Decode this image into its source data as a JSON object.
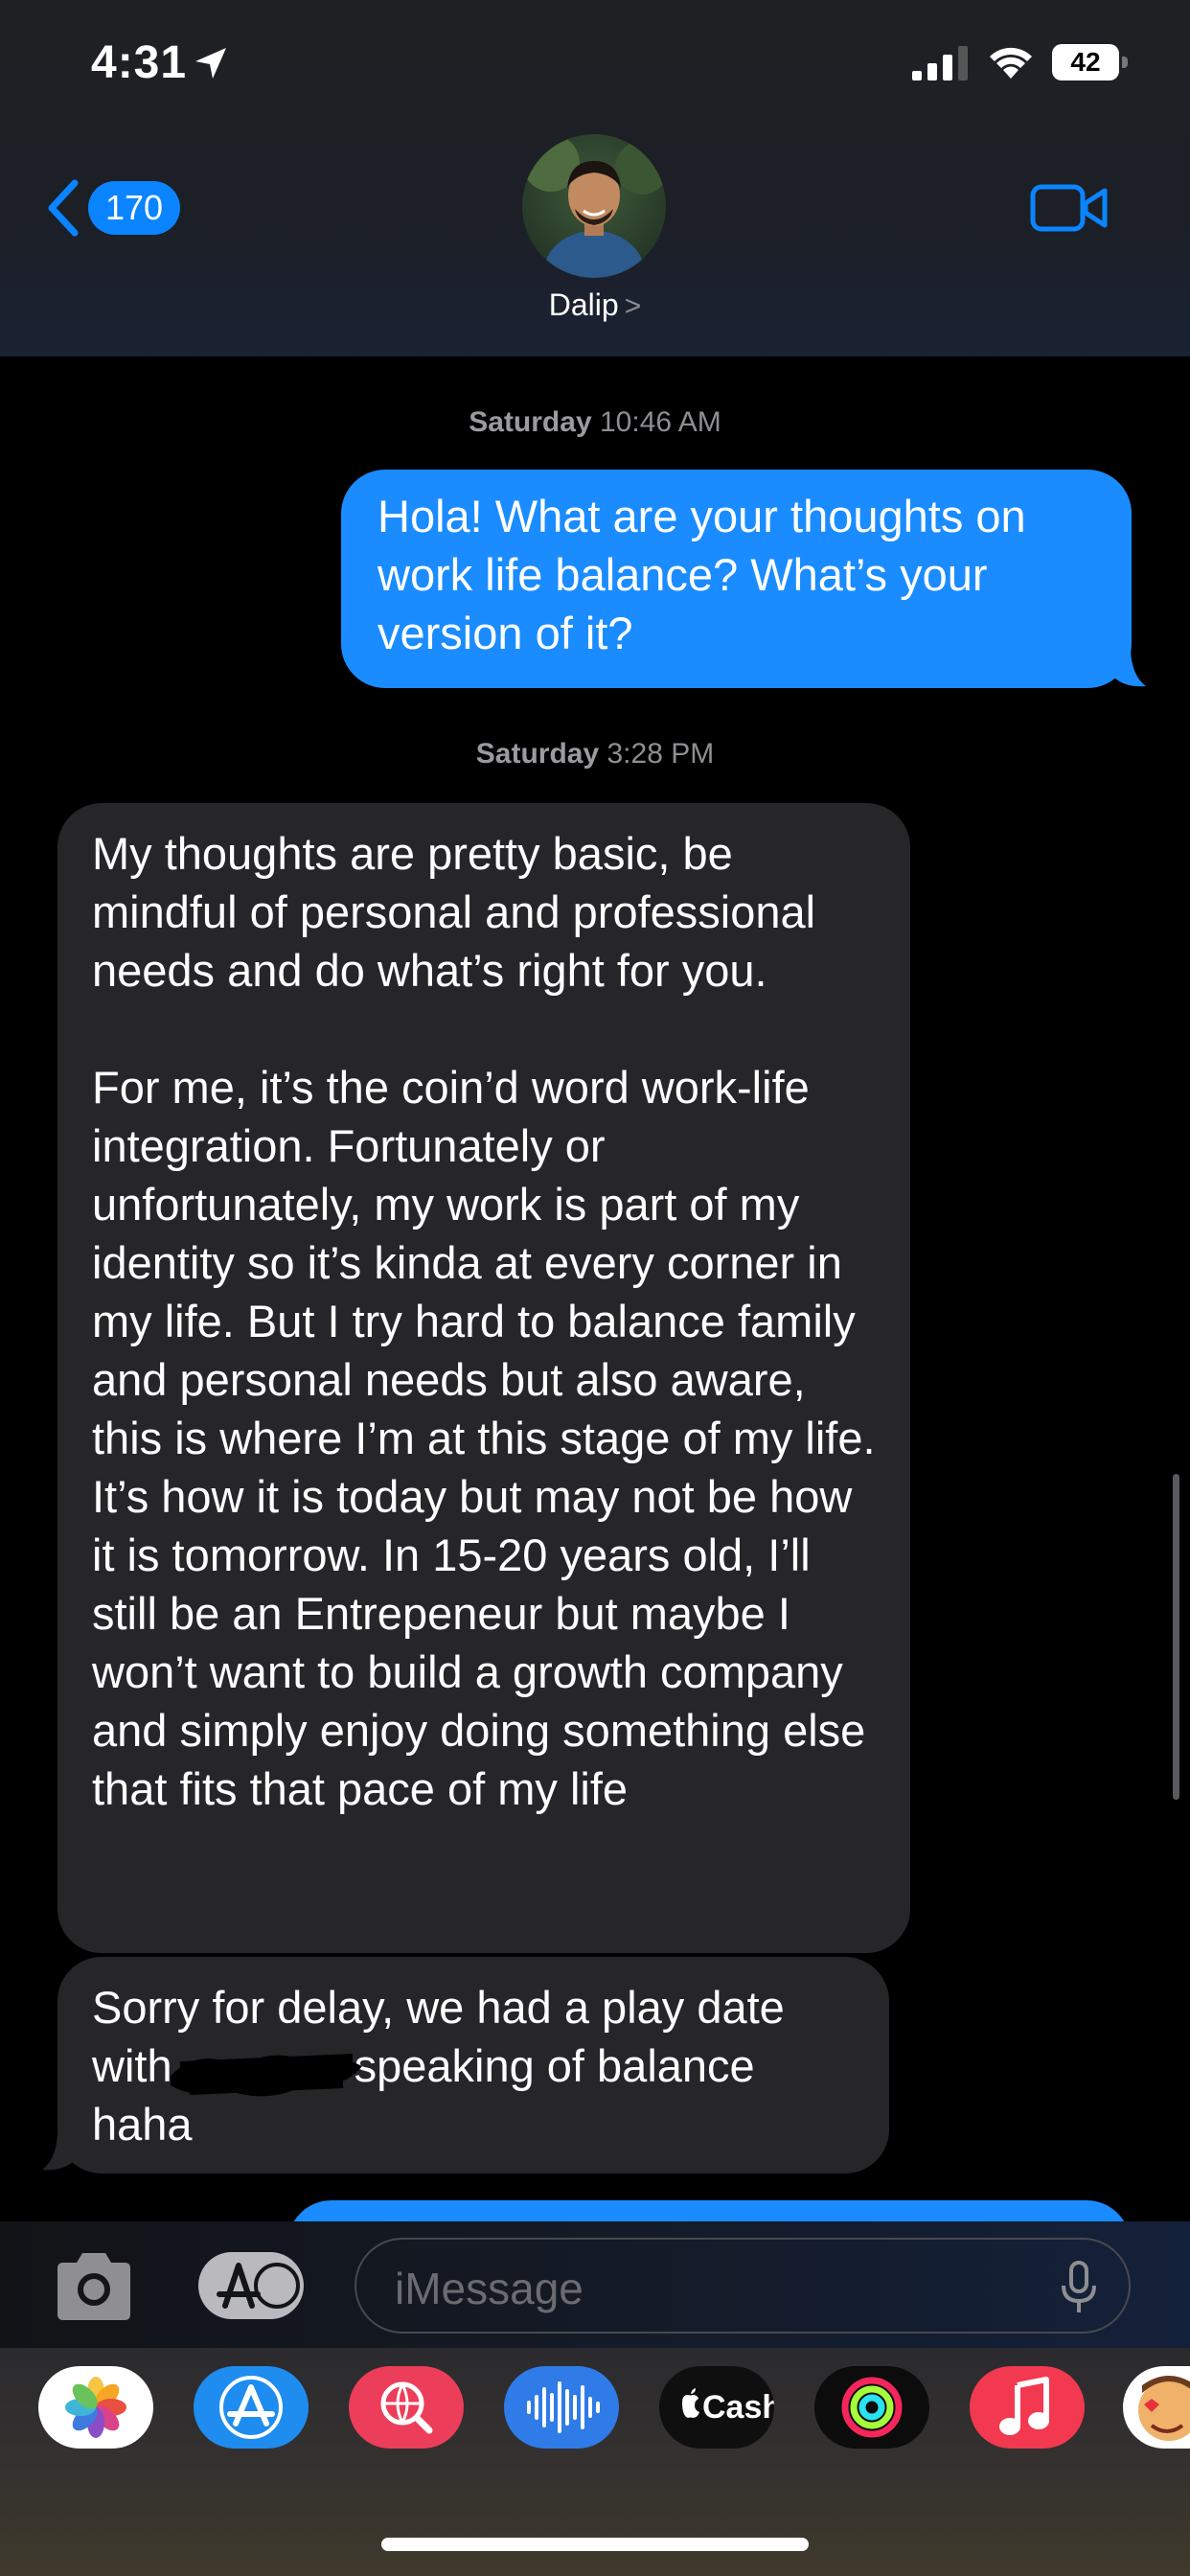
{
  "status_bar": {
    "time": "4:31",
    "battery": "42"
  },
  "header": {
    "back_count": "170",
    "contact_name": "Dalip",
    "contact_chevron": ">"
  },
  "messages": [
    {
      "type": "timestamp",
      "day": "Saturday",
      "time": "10:46 AM"
    },
    {
      "type": "sent",
      "text": "Hola! What are your thoughts on work life balance? What’s your version of it?"
    },
    {
      "type": "timestamp",
      "day": "Saturday",
      "time": "3:28 PM"
    },
    {
      "type": "received",
      "text": "My thoughts are pretty basic, be mindful of personal and professional needs and do what’s right for you.\n\nFor me, it’s the coin’d word work-life integration. Fortunately or unfortunately, my work is part of my identity so it’s kinda at every corner in my life. But I try hard to balance family and personal needs but also aware, this is where I’m at this stage of my life. It’s how it is today but may not be how it is tomorrow. In 15-20 years old, I’ll still be an Entrepeneur but maybe I won’t want to build a growth company and simply enjoy doing something else that fits that pace of my life"
    },
    {
      "type": "received",
      "text_before": "Sorry for delay, we had a play date with",
      "text_after": "speaking of balance haha"
    }
  ],
  "composer": {
    "placeholder": "iMessage"
  },
  "app_drawer": [
    {
      "name": "photos",
      "icon": "photos-icon"
    },
    {
      "name": "app-store",
      "icon": "app-store-icon"
    },
    {
      "name": "images-search",
      "icon": "globe-search-icon"
    },
    {
      "name": "audio-message",
      "icon": "waveform-icon"
    },
    {
      "name": "apple-cash",
      "label": "Cash",
      "icon": "apple-cash-icon"
    },
    {
      "name": "fitness",
      "icon": "activity-rings-icon"
    },
    {
      "name": "music",
      "icon": "music-note-icon"
    },
    {
      "name": "memoji",
      "icon": "memoji-icon"
    }
  ],
  "colors": {
    "sent_bubble": "#1a8cff",
    "received_bubble": "#262629",
    "accent": "#0a84ff"
  }
}
